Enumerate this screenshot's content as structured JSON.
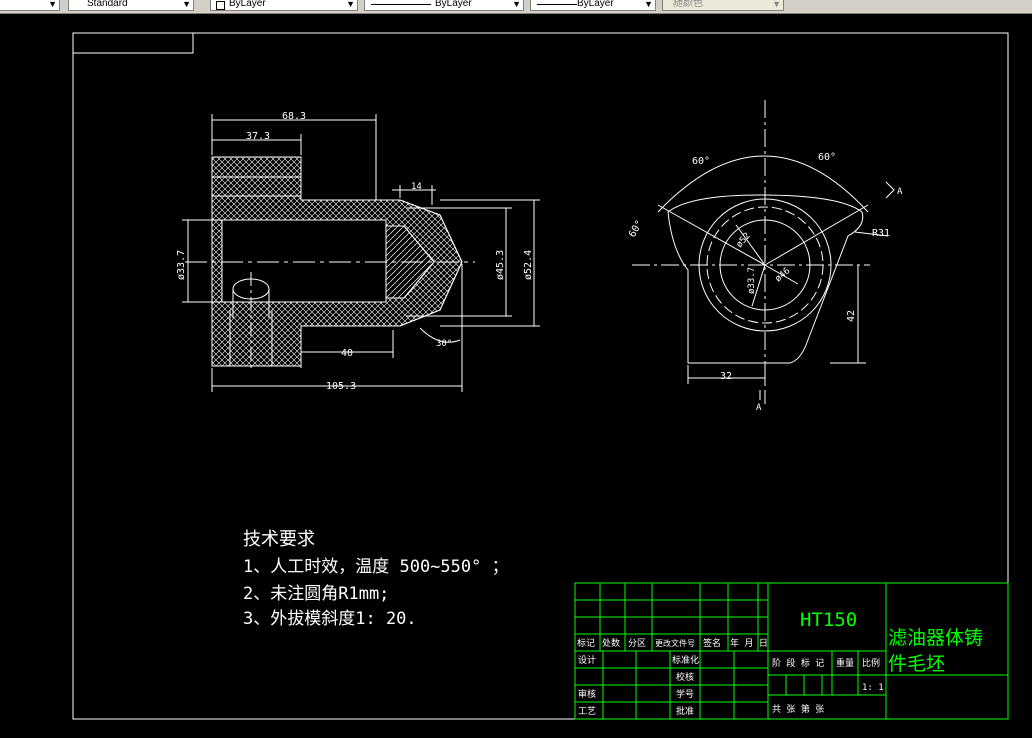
{
  "toolbar": {
    "text_style": "Standard",
    "layer": "ByLayer",
    "linetype": "ByLayer",
    "lineweight": "ByLayer",
    "plot_style": "随颜色"
  },
  "dims": {
    "d68": "68.3",
    "d37": "37.3",
    "d14": "14",
    "d337": "ø33.7",
    "d453": "ø45.3",
    "d524": "ø52.4",
    "d40": "40",
    "d1053": "105.3",
    "d30": "30°",
    "a60l": "60°",
    "a60r": "60°",
    "a60s": "60°",
    "r31": "R31",
    "r52": "ø52",
    "r46": "ø46",
    "r337": "ø33.7",
    "d42": "42",
    "d32": "32",
    "secA": "A",
    "secA2": "A"
  },
  "notes": {
    "title": "技术要求",
    "line1": "1、人工时效，温度 500~550°  ；",
    "line2": "2、未注圆角R1mm;",
    "line3": "3、外拔模斜度1: 20."
  },
  "title_block": {
    "material": "HT150",
    "part_name_1": "滤油器体铸",
    "part_name_2": "件毛坯",
    "hdr_mark": "标记",
    "hdr_count": "处数",
    "hdr_zone": "分区",
    "hdr_change": "更改文件号",
    "hdr_sign": "签名",
    "hdr_date": "年 月 日",
    "design": "设计",
    "standard": "标准化",
    "check": "审核",
    "process": "工艺",
    "approve": "批准",
    "stage": "阶 段 标 记",
    "weight": "重量",
    "ratio": "比例",
    "scale": "1: 1",
    "sheets": "共    张    第    张",
    "review": "校核",
    "proofread": "学号"
  },
  "colors": {
    "draw": "#ffffff",
    "title_grid": "#00ff00",
    "material_text": "#00ff00",
    "background": "#000000"
  }
}
